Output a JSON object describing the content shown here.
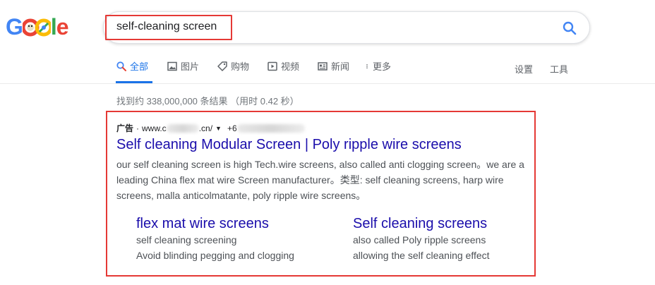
{
  "logo": {
    "text": "Google"
  },
  "search": {
    "query": "self-cleaning screen"
  },
  "tabs": [
    {
      "label": "全部",
      "icon": "search-icon",
      "active": true
    },
    {
      "label": "图片",
      "icon": "image-icon"
    },
    {
      "label": "购物",
      "icon": "tag-icon"
    },
    {
      "label": "视频",
      "icon": "play-icon"
    },
    {
      "label": "新闻",
      "icon": "newspaper-icon"
    },
    {
      "label": "更多",
      "icon": "more-vert-icon"
    }
  ],
  "tools": {
    "settings": "设置",
    "tools": "工具"
  },
  "results": {
    "stats": "找到约 338,000,000 条结果 （用时 0.42 秒）",
    "ad": {
      "label": "广告",
      "url_prefix": "www.c",
      "url_suffix": ".cn/",
      "phone_prefix": "+6",
      "title": "Self cleaning Modular Screen | Poly ripple wire screens",
      "description": "our self cleaning screen is high Tech.wire screens, also called anti clogging screen。we are a leading China flex mat wire Screen manufacturer。类型: self cleaning screens, harp wire screens, malla anticolmatante, poly ripple wire screens。",
      "sitelinks": [
        {
          "title": "flex mat wire screens",
          "line1": "self cleaning screening",
          "line2": "Avoid blinding pegging and clogging"
        },
        {
          "title": "Self cleaning screens",
          "line1": "also called Poly ripple screens",
          "line2": "allowing the self cleaning effect"
        }
      ]
    }
  },
  "colors": {
    "link": "#1a0dab",
    "active_tab": "#1a73e8",
    "highlight": "#e53935"
  }
}
